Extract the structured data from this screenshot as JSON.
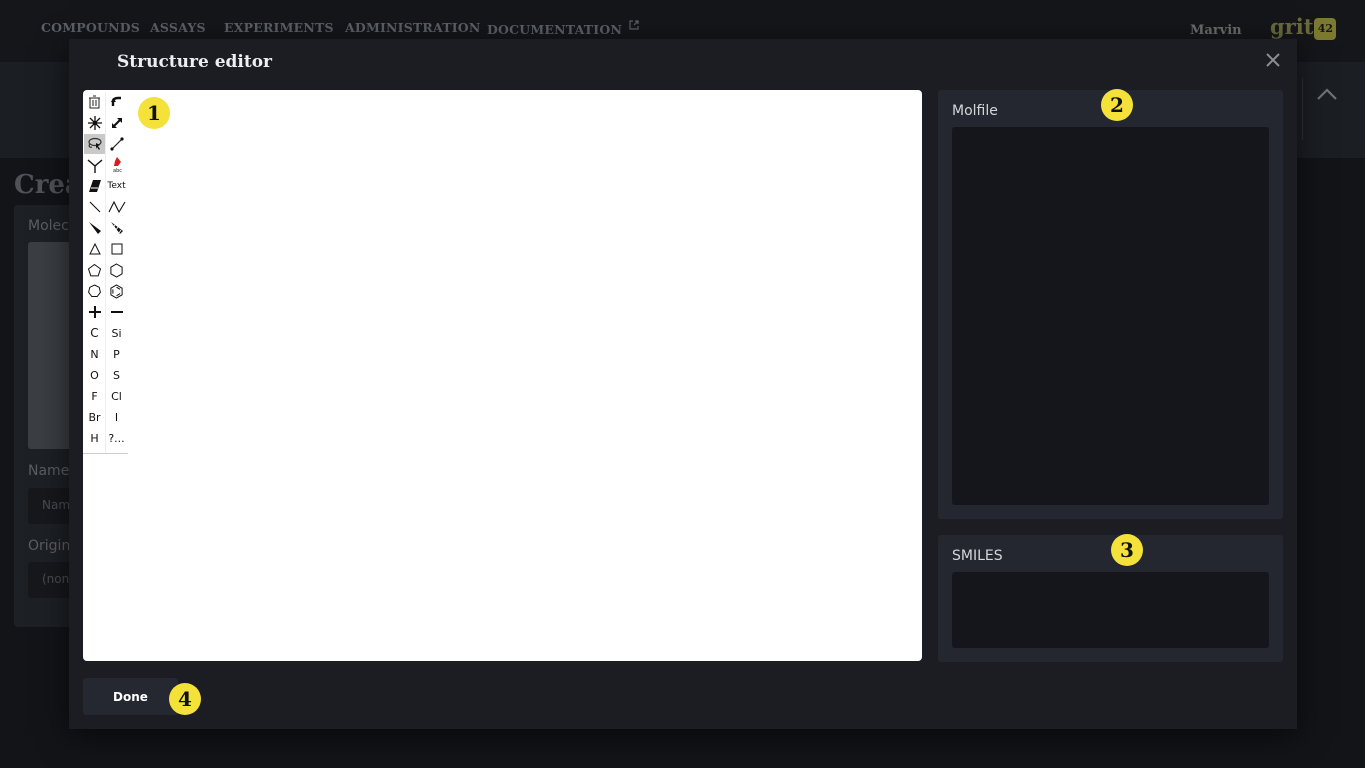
{
  "nav": {
    "items": [
      "COMPOUNDS",
      "ASSAYS",
      "EXPERIMENTS",
      "ADMINISTRATION",
      "DOCUMENTATION"
    ],
    "user": "Marvin",
    "logo_text": "grit",
    "logo_badge": "42"
  },
  "background_page": {
    "title": "Crea",
    "molecule_label": "Molec",
    "name_label": "Name",
    "name_placeholder": "Nam",
    "origin_label": "Origin",
    "origin_value": "(none"
  },
  "modal": {
    "title": "Structure editor",
    "close_icon": "close-icon",
    "molfile_label": "Molfile",
    "molfile_value": "",
    "smiles_label": "SMILES",
    "smiles_value": "",
    "done_label": "Done"
  },
  "toolbar": {
    "text_tool": "Text",
    "elements": [
      "C",
      "Si",
      "N",
      "P",
      "O",
      "S",
      "F",
      "Cl",
      "Br",
      "I",
      "H",
      "?..."
    ]
  },
  "badges": [
    "1",
    "2",
    "3",
    "4"
  ],
  "colors": {
    "accent_badge": "#f4e23a",
    "modal_bg": "#1b1d22",
    "panel_bg": "#242730"
  }
}
